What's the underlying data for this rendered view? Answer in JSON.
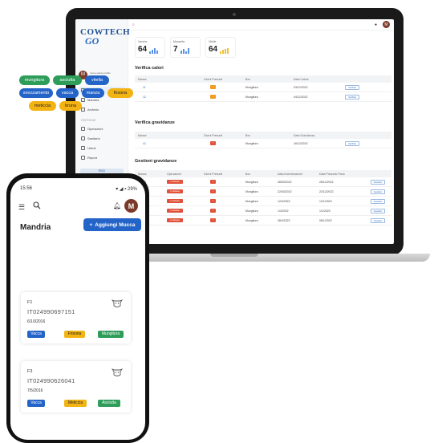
{
  "laptop": {
    "logo_line1": "COWTECH",
    "logo_line2": "GO",
    "user_name": "nome utente profilo",
    "user_sub": "account",
    "avatar_initial": "M",
    "nav": [
      {
        "label": "Home"
      },
      {
        "label": "Mandria"
      },
      {
        "label": "Archivio"
      }
    ],
    "nav_section": "GESTIONE",
    "nav2": [
      {
        "label": "Operazioni"
      },
      {
        "label": "Sanitario"
      },
      {
        "label": "Utenti"
      },
      {
        "label": "Report"
      }
    ],
    "side_button": "ESCI",
    "search_icon": "search-icon",
    "stats": [
      {
        "label": "Vacche",
        "value": "64"
      },
      {
        "label": "Manzette",
        "value": "7"
      },
      {
        "label": "Vitelle",
        "value": "64"
      }
    ],
    "sections": {
      "calori": "Verifica calori",
      "gravidanze": "Verifica gravidanze",
      "gestioni": "Gestioni gravidanze"
    },
    "table_cols": {
      "c1": "Manza",
      "c2": "Giorni Presunti",
      "c3": "Box",
      "c4": "Data Calore"
    },
    "calori_rows": [
      {
        "id": "11",
        "box": "Mungitura",
        "date": "03/12/2022",
        "action": "Verifica"
      },
      {
        "id": "12",
        "box": "Mungitura",
        "date": "04/12/2022",
        "action": "Verifica"
      }
    ],
    "grav_cols": {
      "c1": "Manza",
      "c2": "Giorni Presunti",
      "c3": "Box",
      "c4": "Data Gravidanza"
    },
    "grav_rows": [
      {
        "id": "41",
        "box": "Mungitura",
        "date": "16/12/2022",
        "action": "Verifica"
      }
    ],
    "gest_cols": {
      "c1": "Manza",
      "c2": "Operazione",
      "c3": "Giorni Presunti",
      "c4": "Box",
      "c5": "Data Inseminazione",
      "c6": "Data Presunto Parto"
    },
    "gest_rows": [
      {
        "id": "20",
        "op": "in attesa",
        "box": "Mungitura",
        "d1": "28/03/2022",
        "d2": "28/12/2022",
        "action": "Gestisci"
      },
      {
        "id": "21",
        "op": "in attesa",
        "box": "Mungitura",
        "d1": "22/03/2022",
        "d2": "22/12/2022",
        "action": "Gestisci"
      },
      {
        "id": "22",
        "op": "in attesa",
        "box": "Mungitura",
        "d1": "12/4/2022",
        "d2": "12/1/2023",
        "action": "Gestisci"
      },
      {
        "id": "23",
        "op": "in attesa",
        "box": "Mungitura",
        "d1": "1/4/2022",
        "d2": "1/1/2023",
        "action": "Gestisci"
      },
      {
        "id": "24",
        "op": "in attesa",
        "box": "Mungitura",
        "d1": "08/4/2022",
        "d2": "08/1/2023",
        "action": "Gestisci"
      }
    ]
  },
  "phone": {
    "status_time": "15:56",
    "status_right": "▾ ◢ ▪ 29%",
    "title": "Mandria",
    "add_button": "Aggiungi Mucca",
    "chips": [
      {
        "label": "mungitura",
        "color": "g"
      },
      {
        "label": "asciutta",
        "color": "g"
      },
      {
        "label": "vitella",
        "color": "b"
      },
      {
        "label": "svezzamento",
        "color": "b"
      },
      {
        "label": "vacca",
        "color": "b"
      },
      {
        "label": "manza",
        "color": "b"
      },
      {
        "label": "frisona",
        "color": "y"
      },
      {
        "label": "meticcia",
        "color": "y"
      },
      {
        "label": "bruna",
        "color": "y"
      }
    ],
    "animals": [
      {
        "name": "F1",
        "code": "IT024990697151",
        "date": "6/10/2016",
        "tags": [
          "Vacca",
          "Frisona",
          "Mungitura"
        ]
      },
      {
        "name": "F3",
        "code": "IT024990626041",
        "date": "7/5/2016",
        "tags": [
          "Vacca",
          "Meticcia",
          "Asciutta"
        ]
      }
    ]
  }
}
